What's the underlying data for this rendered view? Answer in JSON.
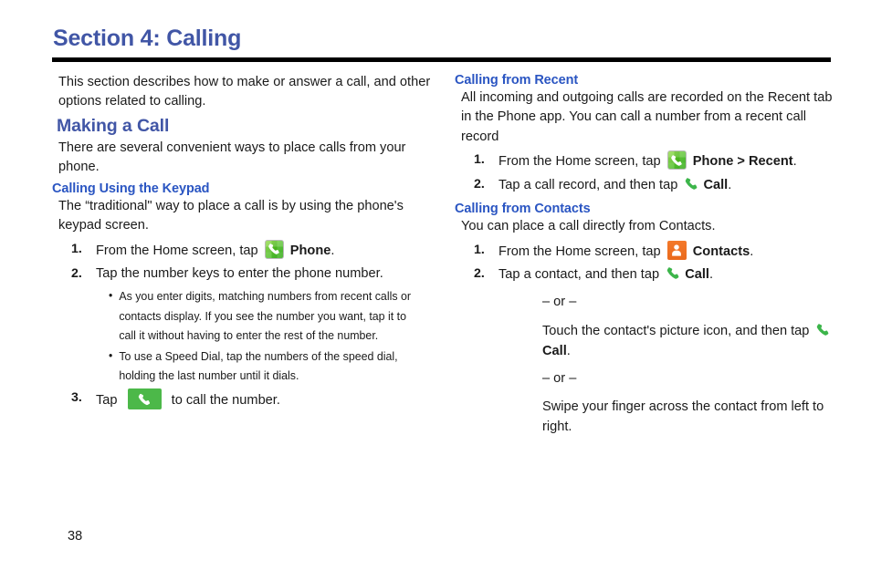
{
  "document": {
    "section_title": "Section 4: Calling",
    "page_number": "38",
    "heading_color": "#4156a6",
    "subheading_color": "#2a55c2",
    "rule_color": "#000000"
  },
  "left_column": {
    "intro": "This section describes how to make or answer a call, and other options related to calling.",
    "h2": "Making a Call",
    "lead": "There are several convenient ways to place calls from your phone.",
    "subsection": {
      "h3": "Calling Using the Keypad",
      "para": "The “traditional\" way to place a call is by using the phone's keypad screen.",
      "steps": [
        {
          "num": "1.",
          "pre": "From the Home screen, tap",
          "icon": "phone-app-icon",
          "bold": "Phone",
          "post": "."
        },
        {
          "num": "2.",
          "pre": "Tap the number keys to enter the phone number.",
          "icon": "",
          "bold": "",
          "post": ""
        },
        {
          "num": "3.",
          "pre": "Tap",
          "icon": "call-button-icon",
          "bold": "",
          "post": "to call the number."
        }
      ],
      "bullets": [
        "As you enter digits, matching numbers from recent calls or contacts display. If you see the number you want, tap it to call it without having to enter the rest of the number.",
        "To use a Speed Dial, tap the numbers of the speed dial, holding the last number until it dials."
      ]
    }
  },
  "right_column": {
    "recent": {
      "h3": "Calling from Recent",
      "para": "All incoming and outgoing calls are recorded on the Recent tab in the Phone app. You can call a number from a recent call record",
      "steps": [
        {
          "num": "1.",
          "pre": "From the Home screen, tap",
          "icon": "phone-app-icon",
          "bold": "Phone > Recent",
          "post": "."
        },
        {
          "num": "2.",
          "pre": "Tap a call record, and then tap",
          "icon": "handset-icon",
          "bold": "Call",
          "post": "."
        }
      ]
    },
    "contacts": {
      "h3": "Calling from Contacts",
      "para": "You can place a call directly from Contacts.",
      "steps": [
        {
          "num": "1.",
          "pre": "From the Home screen, tap",
          "icon": "contacts-app-icon",
          "bold": "Contacts",
          "post": "."
        },
        {
          "num": "2.",
          "pre": "Tap a contact, and then tap",
          "icon": "handset-icon",
          "bold": "Call",
          "post": "."
        }
      ],
      "or_1": "– or –",
      "alt_1_pre": "Touch the contact's picture icon, and then tap",
      "alt_1_bold": "Call",
      "alt_1_post": ".",
      "or_2": "– or –",
      "alt_2": "Swipe your finger across the contact from left to right."
    }
  },
  "icons": {
    "phone_app": "phone-app-icon",
    "contacts_app": "contacts-app-icon",
    "handset": "handset-icon",
    "call_button": "call-button-icon"
  }
}
